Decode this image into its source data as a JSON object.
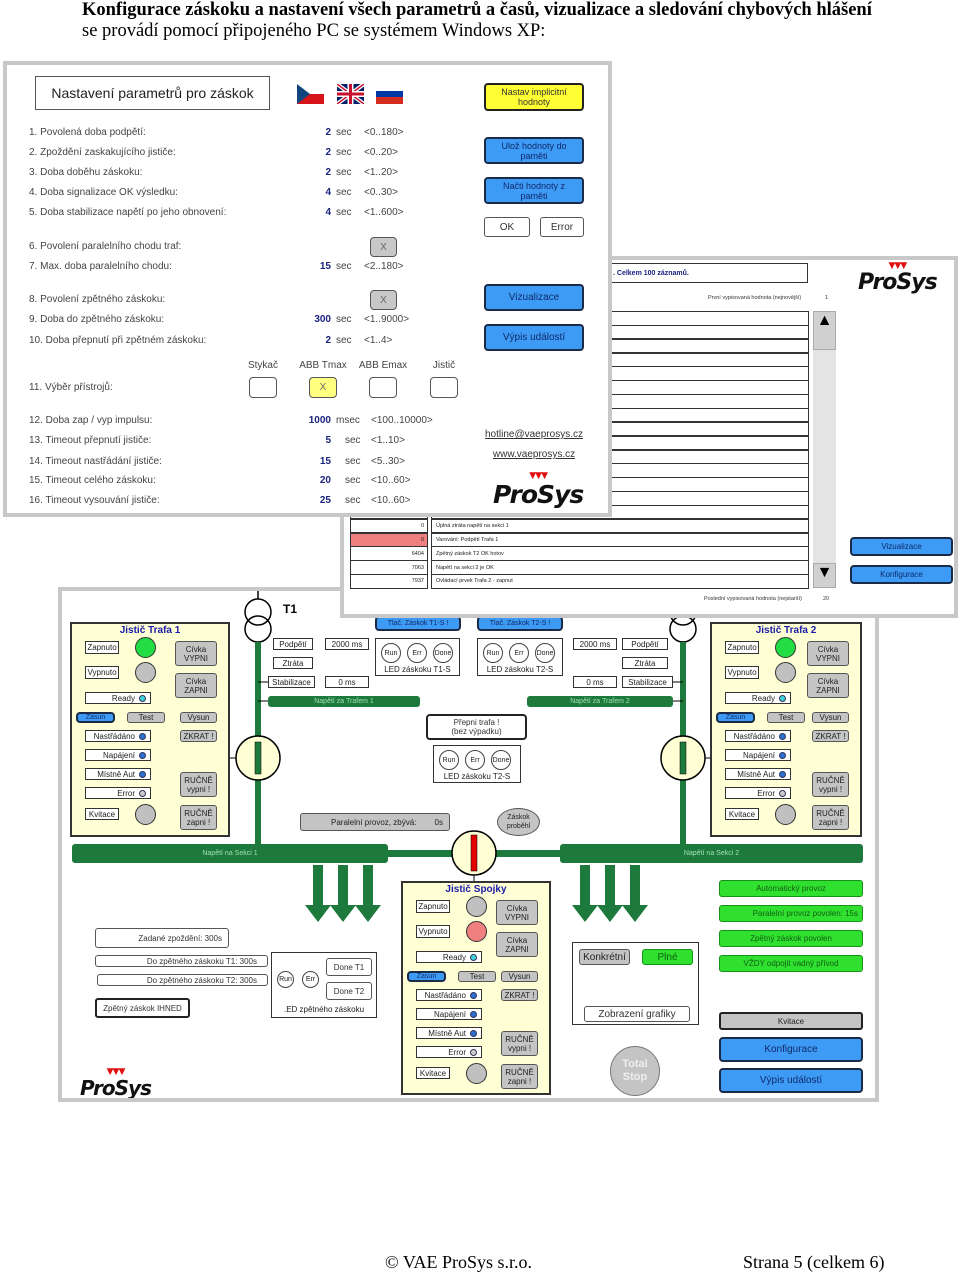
{
  "header": {
    "bold": "Konfigurace záskoku a nastavení všech parametrů a časů, vizualizace a sledování chybových hlášení",
    "rest": " se provádí pomocí připojeného PC se systémem Windows XP:"
  },
  "config": {
    "title": "Nastavení parametrů pro záskok",
    "flags": [
      "cz-flag-icon",
      "uk-flag-icon",
      "ru-flag-icon"
    ],
    "buttons": {
      "defaults": "Nastav implicitní hodnoty",
      "save": "Ulož hodnoty do paměti",
      "load": "Načti hodnoty z paměti",
      "ok": "OK",
      "error": "Error",
      "visual": "Vizualizace",
      "events": "Výpis událostí"
    },
    "params": [
      {
        "label": "1. Povolená doba podpětí:",
        "value": "2",
        "unit": "sec",
        "range": "<0..180>"
      },
      {
        "label": "2. Zpoždění zaskakujícího jističe:",
        "value": "2",
        "unit": "sec",
        "range": "<0..20>"
      },
      {
        "label": "3. Doba doběhu záskoku:",
        "value": "2",
        "unit": "sec",
        "range": "<1..20>"
      },
      {
        "label": "4. Doba signalizace OK výsledku:",
        "value": "4",
        "unit": "sec",
        "range": "<0..30>"
      },
      {
        "label": "5. Doba stabilizace napětí po jeho obnovení:",
        "value": "4",
        "unit": "sec",
        "range": "<1..600>"
      },
      {
        "label": "6. Povolení paralelního chodu traf:",
        "check": "X"
      },
      {
        "label": "7. Max. doba paralelního chodu:",
        "value": "15",
        "unit": "sec",
        "range": "<2..180>"
      },
      {
        "label": "8. Povolení zpětného záskoku:",
        "check": "X"
      },
      {
        "label": "9. Doba do zpětného záskoku:",
        "value": "300",
        "unit": "sec",
        "range": "<1..9000>"
      },
      {
        "label": "10. Doba přepnutí při zpětném záskoku:",
        "value": "2",
        "unit": "sec",
        "range": "<1..4>"
      },
      {
        "label": "11. Výběr přístrojů:"
      },
      {
        "label": "12. Doba zap / vyp impulsu:",
        "value": "1000",
        "unit": "msec",
        "range": "<100..10000>"
      },
      {
        "label": "13. Timeout přepnutí jističe:",
        "value": "5",
        "unit": "sec",
        "range": "<1..10>"
      },
      {
        "label": "14. Timeout nastřádání jističe:",
        "value": "15",
        "unit": "sec",
        "range": "<5..30>"
      },
      {
        "label": "15. Timeout celého záskoku:",
        "value": "20",
        "unit": "sec",
        "range": "<10..60>"
      },
      {
        "label": "16. Timeout vysouvání jističe:",
        "value": "25",
        "unit": "sec",
        "range": "<10..60>"
      }
    ],
    "devices": [
      {
        "label": "Stykač",
        "mark": ""
      },
      {
        "label": "ABB Tmax",
        "mark": "X"
      },
      {
        "label": "ABB Emax",
        "mark": ""
      },
      {
        "label": "Jistič",
        "mark": ""
      }
    ],
    "links": {
      "email": "hotline@vaeprosys.cz",
      "web": "www.vaeprosys.cz"
    },
    "logo": {
      "top": "VAE",
      "text": "ProSys"
    }
  },
  "events": {
    "title": ". Celkem 100 záznamů.",
    "first_label": "První vypisovaná hodnota (nejnovější)",
    "first_value": "1",
    "last_label": "Poslední vypisovaná hodnota (nejstarší)",
    "last_value": "20",
    "rows": [
      {
        "code": "0",
        "text": "Úplná ztráta napětí na sekci 1",
        "alert": false
      },
      {
        "code": "0",
        "text": "Varování: Podpětí Trafa 1",
        "alert": true
      },
      {
        "code": "6404",
        "text": "Zpětný záskok T2 OK hotov",
        "alert": false
      },
      {
        "code": "7063",
        "text": "Napětí na sekci 2 je OK",
        "alert": false
      },
      {
        "code": "7937",
        "text": "Ovládací prvek Trafa 2 - zapnut",
        "alert": false
      }
    ],
    "buttons": {
      "visual": "Vizualizace",
      "config": "Konfigurace"
    },
    "alert_color": "#f08080"
  },
  "vis": {
    "panels": [
      {
        "title": "Jistič Trafa 1",
        "on_color": "#22dd44",
        "off_color": "#c0c0c0"
      },
      {
        "title": "Jistič Trafa 2",
        "on_color": "#22dd44",
        "off_color": "#c0c0c0"
      },
      {
        "title": "Jistič Spojky",
        "on_color": "#c0c0c0",
        "off_color": "#f08080"
      }
    ],
    "panel_labels": {
      "on": "Zapnuto",
      "off": "Vypnuto",
      "coil_off": "Cívka VYPNI",
      "coil_on": "Cívka ZAPNI",
      "ready": "Ready",
      "insert": "Zasun",
      "test": "Test",
      "withdraw": "Vysun",
      "charged": "Nastřádáno",
      "short": "ZKRAT !",
      "power": "Napájení",
      "local": "Místně Aut",
      "manual_off": "RUČNĚ vypni !",
      "error": "Error",
      "ack": "Kvitace",
      "manual_on": "RUČNĚ zapni !"
    },
    "t1": "T1",
    "t1_side": {
      "under": "Podpětí",
      "under_ms": "2000 ms",
      "loss": "Ztráta",
      "stab": "Stabilizace",
      "stab_ms": "0 ms",
      "bus": "Napětí za Trafem 1"
    },
    "t2_side": {
      "under": "Podpětí",
      "under_ms": "2000 ms",
      "loss": "Ztráta",
      "stab": "Stabilizace",
      "stab_ms": "0 ms",
      "bus": "Napětí za Trafem 2"
    },
    "push1": "Tlač. Záskok T1-S !",
    "push2": "Tlač. Záskok T2-S !",
    "led_run": "Run",
    "led_err": "Err",
    "led_done": "Done",
    "led1_label": "LED záskoku T1-S",
    "led2_label": "LED záskoku T2-S",
    "led3_label": "LED záskoku T2-S",
    "switch_tr": "Přepni trafa ! (bez výpadku)",
    "parallel": "Paralelní provoz, zbývá:",
    "parallel_val": "0s",
    "done": "Záskok proběhl",
    "sec1": "Napětí na Sekci 1",
    "sec2": "Napětí na Sekci 2",
    "delay": "Zadané zpoždění:   300s",
    "back_t1": "Do zpětného záskoku T1:   300s",
    "back_t2": "Do zpětného záskoku T2:   300s",
    "back_now": "Zpětný záskok IHNED",
    "done_t1": "Done T1",
    "done_t2": "Done T2",
    "back_led": ".ED zpětného záskoku",
    "gfx": {
      "concrete": "Konkrétní",
      "full": "Plné",
      "show": "Zobrazení grafiky"
    },
    "total_stop": "Total Stop",
    "status": [
      "Automatický provoz",
      "Paralelní provoz povolen:    15s",
      "Zpětný záskok povolen",
      "VŽDY odpojit vadný přívod"
    ],
    "ack": "Kvitace",
    "config": "Konfigurace",
    "events": "Výpis událostí"
  },
  "footer": {
    "copyright": "© VAE ProSys s.r.o.",
    "page": "Strana 5 (celkem 6)"
  }
}
